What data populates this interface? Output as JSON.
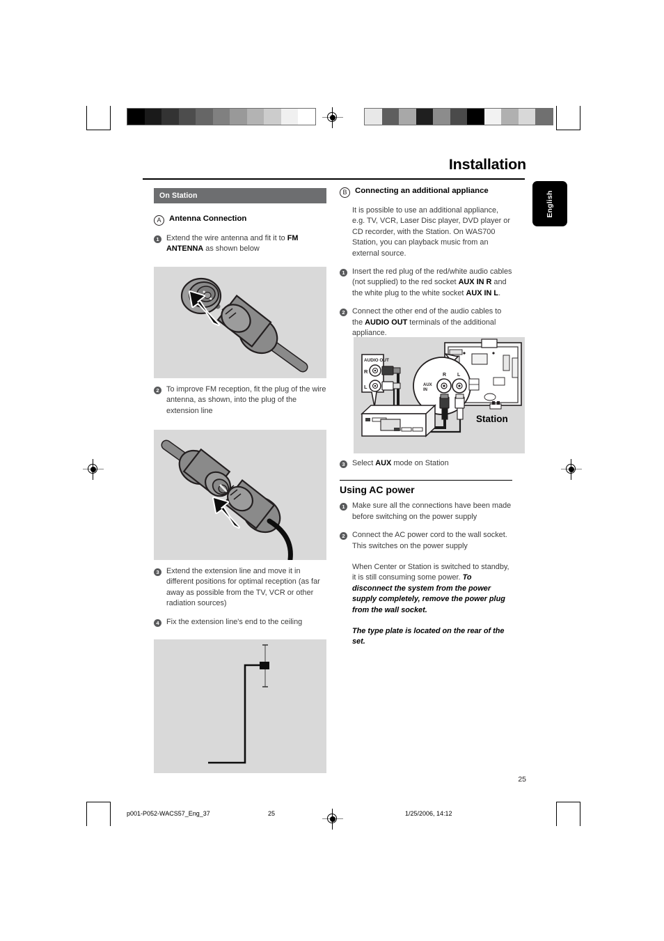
{
  "page": {
    "title": "Installation",
    "language_tab": "English",
    "page_number": "25"
  },
  "footer": {
    "filename": "p001-P052-WACS57_Eng_37",
    "page": "25",
    "timestamp": "1/25/2006, 14:12"
  },
  "left_column": {
    "section_bar": "On Station",
    "section_letter": "A",
    "section_heading": "Antenna Connection",
    "steps": [
      {
        "num": "1",
        "text_before": "Extend the wire antenna and fit it to ",
        "bold": "FM ANTENNA",
        "text_after": " as shown below"
      },
      {
        "num": "2",
        "text_before": "To improve FM reception, fit the plug of the wire antenna, as shown, into the plug of the extension line",
        "bold": "",
        "text_after": ""
      },
      {
        "num": "3",
        "text_before": "Extend the extension line and move it in different positions for optimal reception (as far away as possible from the TV, VCR or other radiation sources)",
        "bold": "",
        "text_after": ""
      },
      {
        "num": "4",
        "text_before": "Fix the extension line's end to the ceiling",
        "bold": "",
        "text_after": ""
      }
    ],
    "figures": [
      {
        "name": "fm-antenna-plug-figure"
      },
      {
        "name": "extension-line-plug-figure"
      },
      {
        "name": "ceiling-mount-figure"
      }
    ]
  },
  "right_column": {
    "section_letter": "B",
    "section_heading": "Connecting an additional appliance",
    "intro": "It is possible to use an additional appliance, e.g. TV, VCR, Laser Disc player, DVD player or CD recorder, with the Station. On WAS700 Station, you can playback music from an external source.",
    "steps": [
      {
        "num": "1",
        "seg1": "Insert the red plug of the red/white audio cables (not supplied) to the red socket ",
        "bold1": "AUX IN R",
        "seg2": " and the white plug to the white socket ",
        "bold2": "AUX IN L",
        "seg3": "."
      },
      {
        "num": "2",
        "seg1": "Connect the other end of the audio cables to the ",
        "bold1": "AUDIO OUT",
        "seg2": " terminals of the additional appliance.",
        "bold2": "",
        "seg3": ""
      },
      {
        "num": "3",
        "seg1": "Select ",
        "bold1": "AUX",
        "seg2": " mode on Station",
        "bold2": "",
        "seg3": ""
      }
    ],
    "diagram": {
      "audio_out_label": "AUDIO OUT",
      "jack_r": "R",
      "jack_l": "L",
      "aux_in_label_line1": "AUX",
      "aux_in_label_line2": "IN",
      "aux_r": "R",
      "aux_l": "L",
      "station_label": "Station"
    },
    "ac_power": {
      "heading": "Using AC power",
      "steps": [
        {
          "num": "1",
          "text": "Make sure all the connections have been made before switching on the power supply"
        },
        {
          "num": "2",
          "text": "Connect the AC power cord to the wall socket. This switches on the power supply"
        }
      ],
      "note_normal": "When Center or Station is switched to standby, it is still consuming some power. ",
      "note_bold": "To disconnect the system from the power supply completely, remove the power plug from the wall socket.",
      "note2": "The type plate is located on the rear of the set."
    }
  },
  "colors": {
    "section_bar": "#6d6e70",
    "figure_bg": "#d9d9d9",
    "body_text": "#3b3b3b",
    "accent_black": "#000000"
  },
  "swatches": {
    "left_bar": [
      "#000000",
      "#1a1a1a",
      "#333333",
      "#4d4d4d",
      "#666666",
      "#808080",
      "#999999",
      "#b3b3b3",
      "#cccccc",
      "#f0f0f0",
      "#ffffff"
    ],
    "right_bar": [
      "#e8e8e8",
      "#5e5e5e",
      "#a8a8a8",
      "#1f1f1f",
      "#8c8c8c",
      "#4a4a4a",
      "#000000",
      "#f2f2f2",
      "#b0b0b0",
      "#d8d8d8",
      "#707070"
    ]
  }
}
